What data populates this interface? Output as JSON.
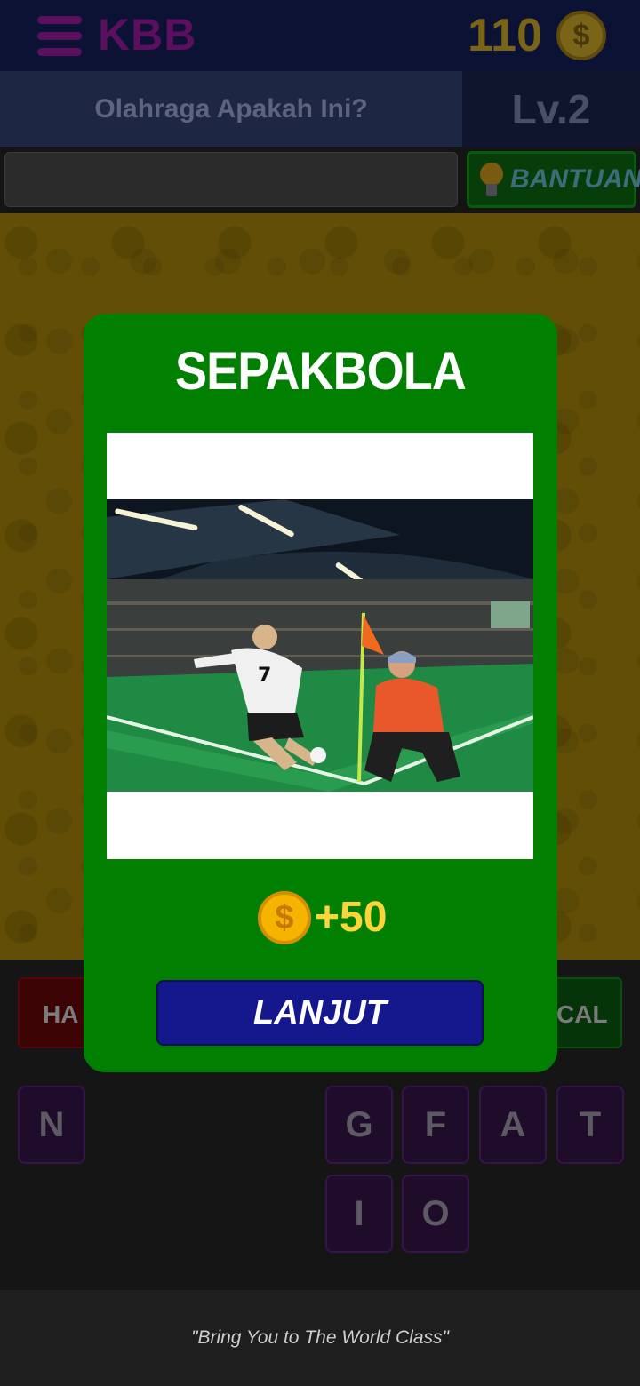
{
  "header": {
    "app_title": "KBB",
    "coins": "110",
    "coin_symbol": "$"
  },
  "question_bar": {
    "question": "Olahraga Apakah Ini?",
    "level": "Lv.2"
  },
  "answer_bar": {
    "answer_value": "",
    "help_label": "BANTUAN"
  },
  "modal": {
    "title": "SEPAKBOLA",
    "coin_symbol": "$",
    "reward": "+50",
    "next_label": "LANJUT"
  },
  "actions": {
    "left_button_visible": "HA",
    "right_button_visible": "CAL"
  },
  "letters": {
    "row1": [
      "N",
      "G",
      "F",
      "A",
      "T"
    ],
    "row2": [
      "I",
      "O"
    ]
  },
  "footer": {
    "tagline": "\"Bring You to The World Class\""
  },
  "colors": {
    "modal_green": "#007f00",
    "next_button_blue": "#15188c",
    "reward_gold": "#ffd43b",
    "top_bar": "#0c1233"
  },
  "icons": [
    "menu-icon",
    "coin-icon",
    "lightbulb-icon"
  ]
}
